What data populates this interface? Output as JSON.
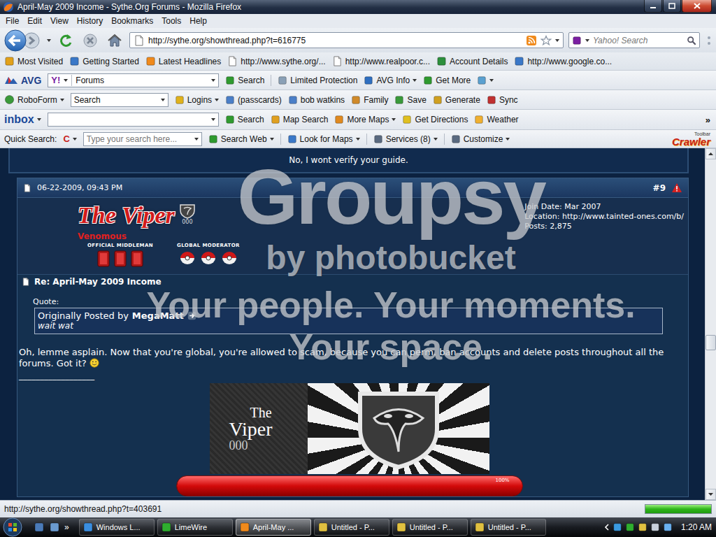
{
  "window": {
    "title": "April-May 2009 Income - Sythe.Org Forums - Mozilla Firefox"
  },
  "menu": [
    "File",
    "Edit",
    "View",
    "History",
    "Bookmarks",
    "Tools",
    "Help"
  ],
  "navigation": {
    "url": "http://sythe.org/showthread.php?t=616775",
    "search_placeholder": "Yahoo! Search"
  },
  "bookmarks": [
    "Most Visited",
    "Getting Started",
    "Latest Headlines",
    "http://www.sythe.org/...",
    "http://www.realpoor.c...",
    "Account Details",
    "http://www.google.co..."
  ],
  "avg_toolbar": {
    "logo": "AVG",
    "engine": "Y!",
    "query": "Forums",
    "items": [
      {
        "label": "Search",
        "menu": false
      },
      {
        "label": "Limited Protection",
        "menu": false
      },
      {
        "label": "AVG Info",
        "menu": true
      },
      {
        "label": "Get More",
        "menu": false
      }
    ]
  },
  "roboform_toolbar": {
    "logo": "RoboForm",
    "field": "Search",
    "items": [
      {
        "label": "Logins",
        "menu": true
      },
      {
        "label": "(passcards)",
        "menu": false
      },
      {
        "label": "bob watkins",
        "menu": false
      },
      {
        "label": "Family",
        "menu": false
      },
      {
        "label": "Save",
        "menu": false
      },
      {
        "label": "Generate",
        "menu": false
      },
      {
        "label": "Sync",
        "menu": false
      }
    ]
  },
  "inbox_toolbar": {
    "logo": "inbox",
    "items": [
      {
        "label": "Search",
        "menu": false
      },
      {
        "label": "Map Search",
        "menu": false
      },
      {
        "label": "More Maps",
        "menu": true
      },
      {
        "label": "Get Directions",
        "menu": false
      },
      {
        "label": "Weather",
        "menu": false
      }
    ],
    "more": "»"
  },
  "quick_search_toolbar": {
    "label": "Quick Search:",
    "engine": "C",
    "placeholder": "Type your search here...",
    "items": [
      {
        "label": "Search Web",
        "menu": true
      },
      {
        "label": "Look for Maps",
        "menu": true
      },
      {
        "label": "Services (8)",
        "menu": true
      },
      {
        "label": "Customize",
        "menu": true
      }
    ],
    "brand_small": "Toolbar",
    "brand": "Crawler"
  },
  "previous_post": {
    "signature_line": "No, I wont verify your guide."
  },
  "post": {
    "date": "06-22-2009, 09:43 PM",
    "number": "#9",
    "user": {
      "name": "The Viper",
      "badge": "000",
      "rank": "Venomous",
      "titles": [
        {
          "label": "OFFICIAL MIDDLEMAN",
          "icons": 3
        },
        {
          "label": "GLOBAL MODERATOR",
          "icons": 3
        }
      ]
    },
    "info": [
      "Join Date: Mar 2007",
      "Location: http://www.tainted-ones.com/b/",
      "Posts: 2,875"
    ],
    "title": "Re: April-May 2009 Income",
    "quote": {
      "label": "Quote:",
      "prefix": "Originally Posted by",
      "author": "MegaMatt",
      "text": "wait wat"
    },
    "body": "Oh, lemme asplain. Now that you're global, you're allowed to scam, because you can perm. ban accounts and delete posts throughout all the forums. Got it?",
    "signature": {
      "separator": "__________________",
      "banner": {
        "small": "The",
        "big": "Viper",
        "code": "000"
      },
      "bar": {
        "level": 1,
        "reading": "100%"
      }
    }
  },
  "watermark": {
    "brand": "Groupsy",
    "by": "by photobucket",
    "tagline": "Your people. Your moments.",
    "tagline2": "Your space."
  },
  "scrollbar": {
    "level": 0.56
  },
  "status_bar": {
    "text": "http://sythe.org/showthread.php?t=403691",
    "level": 1
  },
  "taskbar": {
    "quicklaunch_more": "»",
    "items": [
      {
        "label": "Windows L...",
        "selected": false
      },
      {
        "label": "LimeWire",
        "selected": false
      },
      {
        "label": "April-May ...",
        "selected": true
      },
      {
        "label": "Untitled - P...",
        "selected": false
      },
      {
        "label": "Untitled - P...",
        "selected": false
      },
      {
        "label": "Untitled - P...",
        "selected": false
      }
    ],
    "clock": "1:20 AM"
  }
}
